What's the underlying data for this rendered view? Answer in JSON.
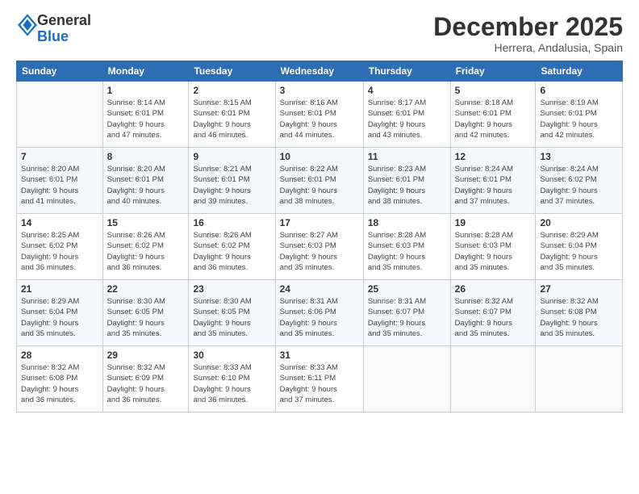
{
  "logo": {
    "general": "General",
    "blue": "Blue"
  },
  "header": {
    "month": "December 2025",
    "location": "Herrera, Andalusia, Spain"
  },
  "weekdays": [
    "Sunday",
    "Monday",
    "Tuesday",
    "Wednesday",
    "Thursday",
    "Friday",
    "Saturday"
  ],
  "weeks": [
    [
      {
        "day": "",
        "info": ""
      },
      {
        "day": "1",
        "info": "Sunrise: 8:14 AM\nSunset: 6:01 PM\nDaylight: 9 hours\nand 47 minutes."
      },
      {
        "day": "2",
        "info": "Sunrise: 8:15 AM\nSunset: 6:01 PM\nDaylight: 9 hours\nand 46 minutes."
      },
      {
        "day": "3",
        "info": "Sunrise: 8:16 AM\nSunset: 6:01 PM\nDaylight: 9 hours\nand 44 minutes."
      },
      {
        "day": "4",
        "info": "Sunrise: 8:17 AM\nSunset: 6:01 PM\nDaylight: 9 hours\nand 43 minutes."
      },
      {
        "day": "5",
        "info": "Sunrise: 8:18 AM\nSunset: 6:01 PM\nDaylight: 9 hours\nand 42 minutes."
      },
      {
        "day": "6",
        "info": "Sunrise: 8:19 AM\nSunset: 6:01 PM\nDaylight: 9 hours\nand 42 minutes."
      }
    ],
    [
      {
        "day": "7",
        "info": "Sunrise: 8:20 AM\nSunset: 6:01 PM\nDaylight: 9 hours\nand 41 minutes."
      },
      {
        "day": "8",
        "info": "Sunrise: 8:20 AM\nSunset: 6:01 PM\nDaylight: 9 hours\nand 40 minutes."
      },
      {
        "day": "9",
        "info": "Sunrise: 8:21 AM\nSunset: 6:01 PM\nDaylight: 9 hours\nand 39 minutes."
      },
      {
        "day": "10",
        "info": "Sunrise: 8:22 AM\nSunset: 6:01 PM\nDaylight: 9 hours\nand 38 minutes."
      },
      {
        "day": "11",
        "info": "Sunrise: 8:23 AM\nSunset: 6:01 PM\nDaylight: 9 hours\nand 38 minutes."
      },
      {
        "day": "12",
        "info": "Sunrise: 8:24 AM\nSunset: 6:01 PM\nDaylight: 9 hours\nand 37 minutes."
      },
      {
        "day": "13",
        "info": "Sunrise: 8:24 AM\nSunset: 6:02 PM\nDaylight: 9 hours\nand 37 minutes."
      }
    ],
    [
      {
        "day": "14",
        "info": "Sunrise: 8:25 AM\nSunset: 6:02 PM\nDaylight: 9 hours\nand 36 minutes."
      },
      {
        "day": "15",
        "info": "Sunrise: 8:26 AM\nSunset: 6:02 PM\nDaylight: 9 hours\nand 36 minutes."
      },
      {
        "day": "16",
        "info": "Sunrise: 8:26 AM\nSunset: 6:02 PM\nDaylight: 9 hours\nand 36 minutes."
      },
      {
        "day": "17",
        "info": "Sunrise: 8:27 AM\nSunset: 6:03 PM\nDaylight: 9 hours\nand 35 minutes."
      },
      {
        "day": "18",
        "info": "Sunrise: 8:28 AM\nSunset: 6:03 PM\nDaylight: 9 hours\nand 35 minutes."
      },
      {
        "day": "19",
        "info": "Sunrise: 8:28 AM\nSunset: 6:03 PM\nDaylight: 9 hours\nand 35 minutes."
      },
      {
        "day": "20",
        "info": "Sunrise: 8:29 AM\nSunset: 6:04 PM\nDaylight: 9 hours\nand 35 minutes."
      }
    ],
    [
      {
        "day": "21",
        "info": "Sunrise: 8:29 AM\nSunset: 6:04 PM\nDaylight: 9 hours\nand 35 minutes."
      },
      {
        "day": "22",
        "info": "Sunrise: 8:30 AM\nSunset: 6:05 PM\nDaylight: 9 hours\nand 35 minutes."
      },
      {
        "day": "23",
        "info": "Sunrise: 8:30 AM\nSunset: 6:05 PM\nDaylight: 9 hours\nand 35 minutes."
      },
      {
        "day": "24",
        "info": "Sunrise: 8:31 AM\nSunset: 6:06 PM\nDaylight: 9 hours\nand 35 minutes."
      },
      {
        "day": "25",
        "info": "Sunrise: 8:31 AM\nSunset: 6:07 PM\nDaylight: 9 hours\nand 35 minutes."
      },
      {
        "day": "26",
        "info": "Sunrise: 8:32 AM\nSunset: 6:07 PM\nDaylight: 9 hours\nand 35 minutes."
      },
      {
        "day": "27",
        "info": "Sunrise: 8:32 AM\nSunset: 6:08 PM\nDaylight: 9 hours\nand 35 minutes."
      }
    ],
    [
      {
        "day": "28",
        "info": "Sunrise: 8:32 AM\nSunset: 6:08 PM\nDaylight: 9 hours\nand 36 minutes."
      },
      {
        "day": "29",
        "info": "Sunrise: 8:32 AM\nSunset: 6:09 PM\nDaylight: 9 hours\nand 36 minutes."
      },
      {
        "day": "30",
        "info": "Sunrise: 8:33 AM\nSunset: 6:10 PM\nDaylight: 9 hours\nand 36 minutes."
      },
      {
        "day": "31",
        "info": "Sunrise: 8:33 AM\nSunset: 6:11 PM\nDaylight: 9 hours\nand 37 minutes."
      },
      {
        "day": "",
        "info": ""
      },
      {
        "day": "",
        "info": ""
      },
      {
        "day": "",
        "info": ""
      }
    ]
  ]
}
